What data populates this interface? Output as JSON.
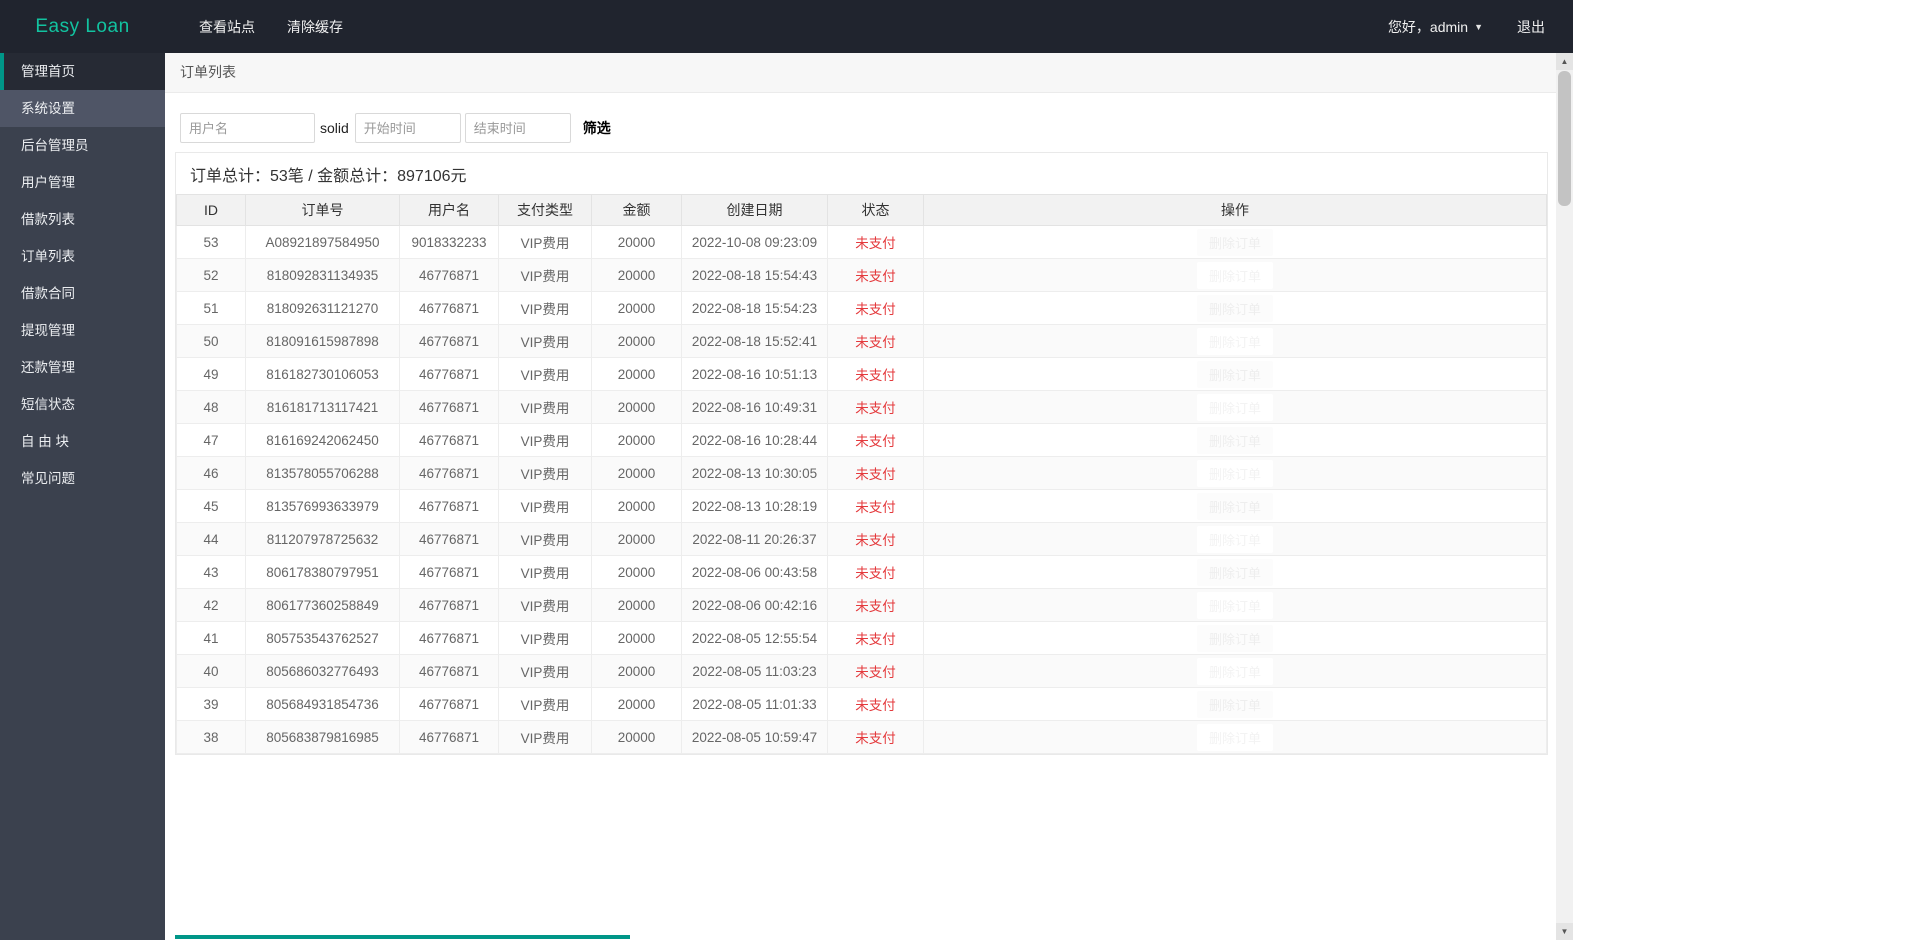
{
  "colors": {
    "accent": "#009688",
    "brand": "#12c3a0",
    "status_red": "#e4393c",
    "navbar_bg": "#20242e",
    "sidebar_bg": "#3b414e"
  },
  "navbar": {
    "brand": "Easy Loan",
    "links": [
      "查看站点",
      "清除缓存"
    ],
    "greeting": "您好，admin",
    "logout": "退出"
  },
  "sidebar": {
    "items": [
      {
        "label": "管理首页",
        "state": "active"
      },
      {
        "label": "系统设置",
        "state": "hover"
      },
      {
        "label": "后台管理员",
        "state": "normal"
      },
      {
        "label": "用户管理",
        "state": "normal"
      },
      {
        "label": "借款列表",
        "state": "normal"
      },
      {
        "label": "订单列表",
        "state": "normal"
      },
      {
        "label": "借款合同",
        "state": "normal"
      },
      {
        "label": "提现管理",
        "state": "normal"
      },
      {
        "label": "还款管理",
        "state": "normal"
      },
      {
        "label": "短信状态",
        "state": "normal"
      },
      {
        "label": "自 由 块",
        "state": "normal"
      },
      {
        "label": "常见问题",
        "state": "normal"
      }
    ]
  },
  "breadcrumb": {
    "title": "订单列表"
  },
  "filter": {
    "username_placeholder": "用户名",
    "solid_text": "solid",
    "start_placeholder": "开始时间",
    "end_placeholder": "结束时间",
    "submit_label": "筛选"
  },
  "summary": {
    "text": "订单总计：53笔 / 金额总计：897106元"
  },
  "table": {
    "headers": [
      "ID",
      "订单号",
      "用户名",
      "支付类型",
      "金额",
      "创建日期",
      "状态",
      "操作"
    ],
    "status_label": "未支付",
    "action_label": "删除订单",
    "rows": [
      {
        "id": "53",
        "order_no": "A08921897584950",
        "username": "9018332233",
        "pay_type": "VIP费用",
        "amount": "20000",
        "created": "2022-10-08 09:23:09"
      },
      {
        "id": "52",
        "order_no": "818092831134935",
        "username": "46776871",
        "pay_type": "VIP费用",
        "amount": "20000",
        "created": "2022-08-18 15:54:43"
      },
      {
        "id": "51",
        "order_no": "818092631121270",
        "username": "46776871",
        "pay_type": "VIP费用",
        "amount": "20000",
        "created": "2022-08-18 15:54:23"
      },
      {
        "id": "50",
        "order_no": "818091615987898",
        "username": "46776871",
        "pay_type": "VIP费用",
        "amount": "20000",
        "created": "2022-08-18 15:52:41"
      },
      {
        "id": "49",
        "order_no": "816182730106053",
        "username": "46776871",
        "pay_type": "VIP费用",
        "amount": "20000",
        "created": "2022-08-16 10:51:13"
      },
      {
        "id": "48",
        "order_no": "816181713117421",
        "username": "46776871",
        "pay_type": "VIP费用",
        "amount": "20000",
        "created": "2022-08-16 10:49:31"
      },
      {
        "id": "47",
        "order_no": "816169242062450",
        "username": "46776871",
        "pay_type": "VIP费用",
        "amount": "20000",
        "created": "2022-08-16 10:28:44"
      },
      {
        "id": "46",
        "order_no": "813578055706288",
        "username": "46776871",
        "pay_type": "VIP费用",
        "amount": "20000",
        "created": "2022-08-13 10:30:05"
      },
      {
        "id": "45",
        "order_no": "813576993633979",
        "username": "46776871",
        "pay_type": "VIP费用",
        "amount": "20000",
        "created": "2022-08-13 10:28:19"
      },
      {
        "id": "44",
        "order_no": "811207978725632",
        "username": "46776871",
        "pay_type": "VIP费用",
        "amount": "20000",
        "created": "2022-08-11 20:26:37"
      },
      {
        "id": "43",
        "order_no": "806178380797951",
        "username": "46776871",
        "pay_type": "VIP费用",
        "amount": "20000",
        "created": "2022-08-06 00:43:58"
      },
      {
        "id": "42",
        "order_no": "806177360258849",
        "username": "46776871",
        "pay_type": "VIP费用",
        "amount": "20000",
        "created": "2022-08-06 00:42:16"
      },
      {
        "id": "41",
        "order_no": "805753543762527",
        "username": "46776871",
        "pay_type": "VIP费用",
        "amount": "20000",
        "created": "2022-08-05 12:55:54"
      },
      {
        "id": "40",
        "order_no": "805686032776493",
        "username": "46776871",
        "pay_type": "VIP费用",
        "amount": "20000",
        "created": "2022-08-05 11:03:23"
      },
      {
        "id": "39",
        "order_no": "805684931854736",
        "username": "46776871",
        "pay_type": "VIP费用",
        "amount": "20000",
        "created": "2022-08-05 11:01:33"
      },
      {
        "id": "38",
        "order_no": "805683879816985",
        "username": "46776871",
        "pay_type": "VIP费用",
        "amount": "20000",
        "created": "2022-08-05 10:59:47"
      }
    ]
  },
  "scrollbar": {
    "up_glyph": "▲",
    "down_glyph": "▼"
  }
}
